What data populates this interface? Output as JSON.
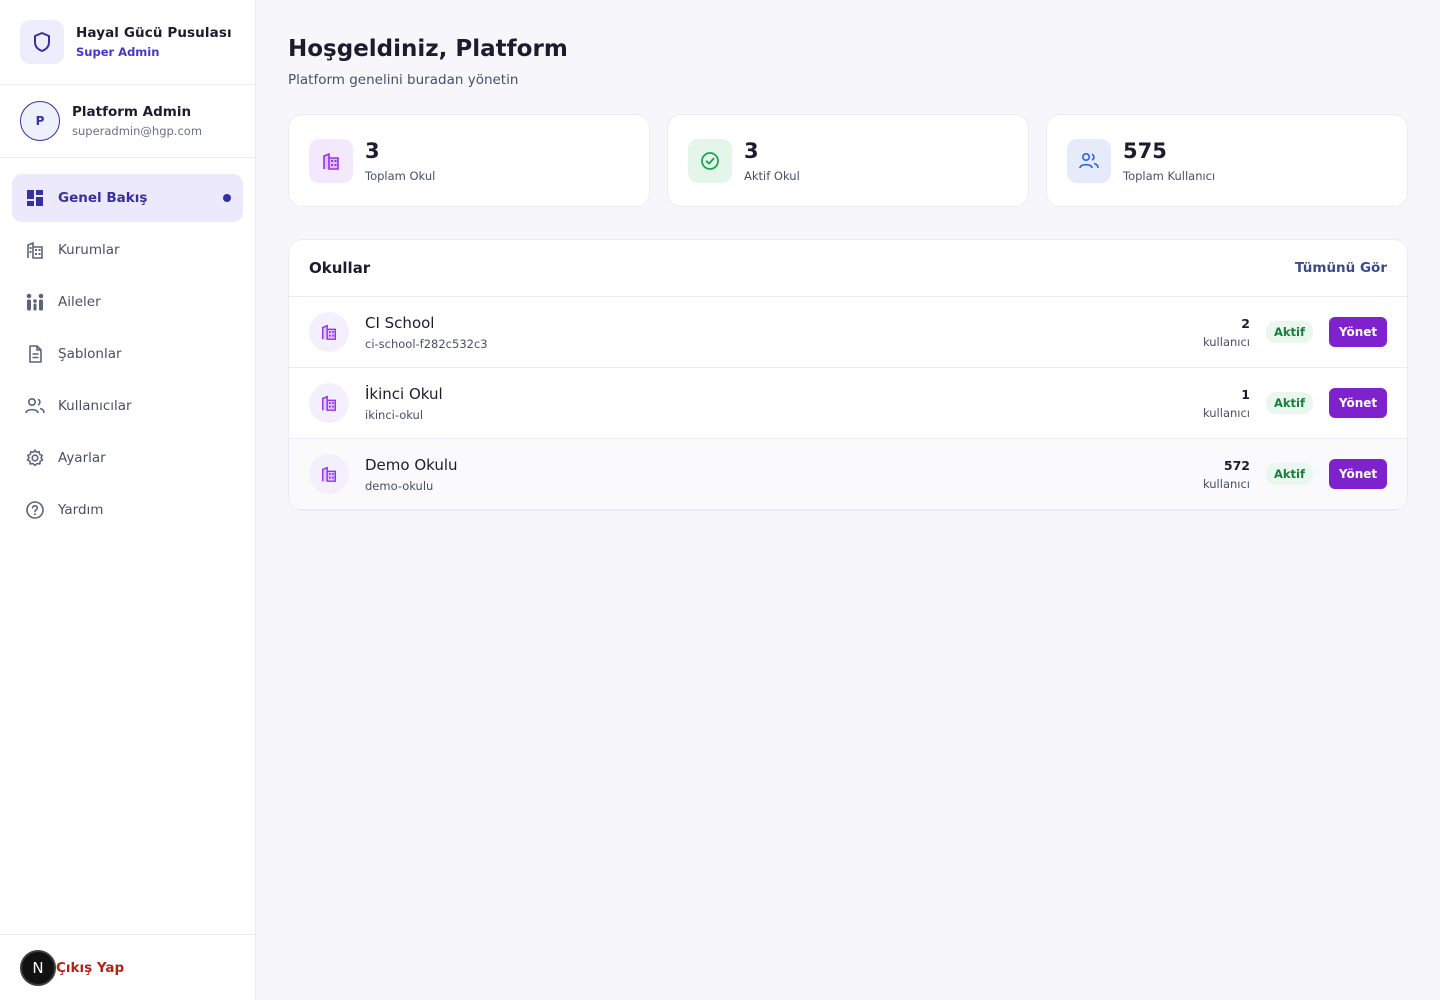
{
  "brand": {
    "title": "Hayal Gücü Pusulası",
    "role": "Super Admin"
  },
  "profile": {
    "initial": "P",
    "name": "Platform Admin",
    "email": "superadmin@hgp.com"
  },
  "nav": {
    "items": [
      {
        "label": "Genel Bakış",
        "icon": "dashboard-icon",
        "active": true
      },
      {
        "label": "Kurumlar",
        "icon": "building-icon"
      },
      {
        "label": "Aileler",
        "icon": "family-icon"
      },
      {
        "label": "Şablonlar",
        "icon": "document-icon"
      },
      {
        "label": "Kullanıcılar",
        "icon": "users-icon"
      },
      {
        "label": "Ayarlar",
        "icon": "gear-icon"
      },
      {
        "label": "Yardım",
        "icon": "help-icon"
      }
    ]
  },
  "footer": {
    "badge": "N",
    "logout_label": "Çıkış Yap"
  },
  "header": {
    "title": "Hoşgeldiniz, Platform",
    "subtitle": "Platform genelini buradan yönetin"
  },
  "stats": [
    {
      "value": "3",
      "label": "Toplam Okul",
      "icon": "building-icon"
    },
    {
      "value": "3",
      "label": "Aktif Okul",
      "icon": "check-circle-icon"
    },
    {
      "value": "575",
      "label": "Toplam Kullanıcı",
      "icon": "users-icon"
    }
  ],
  "schools": {
    "title": "Okullar",
    "see_all": "Tümünü Gör",
    "rows": [
      {
        "name": "CI School",
        "slug": "ci-school-f282c532c3",
        "count": "2",
        "count_label": "kullanıcı",
        "status": "Aktif",
        "action": "Yönet"
      },
      {
        "name": "İkinci Okul",
        "slug": "ikinci-okul",
        "count": "1",
        "count_label": "kullanıcı",
        "status": "Aktif",
        "action": "Yönet"
      },
      {
        "name": "Demo Okulu",
        "slug": "demo-okulu",
        "count": "572",
        "count_label": "kullanıcı",
        "status": "Aktif",
        "action": "Yönet"
      }
    ]
  },
  "colors": {
    "primary": "#3730a3",
    "accent_purple": "#7e22ce",
    "success": "#15803d",
    "danger": "#b42318"
  }
}
